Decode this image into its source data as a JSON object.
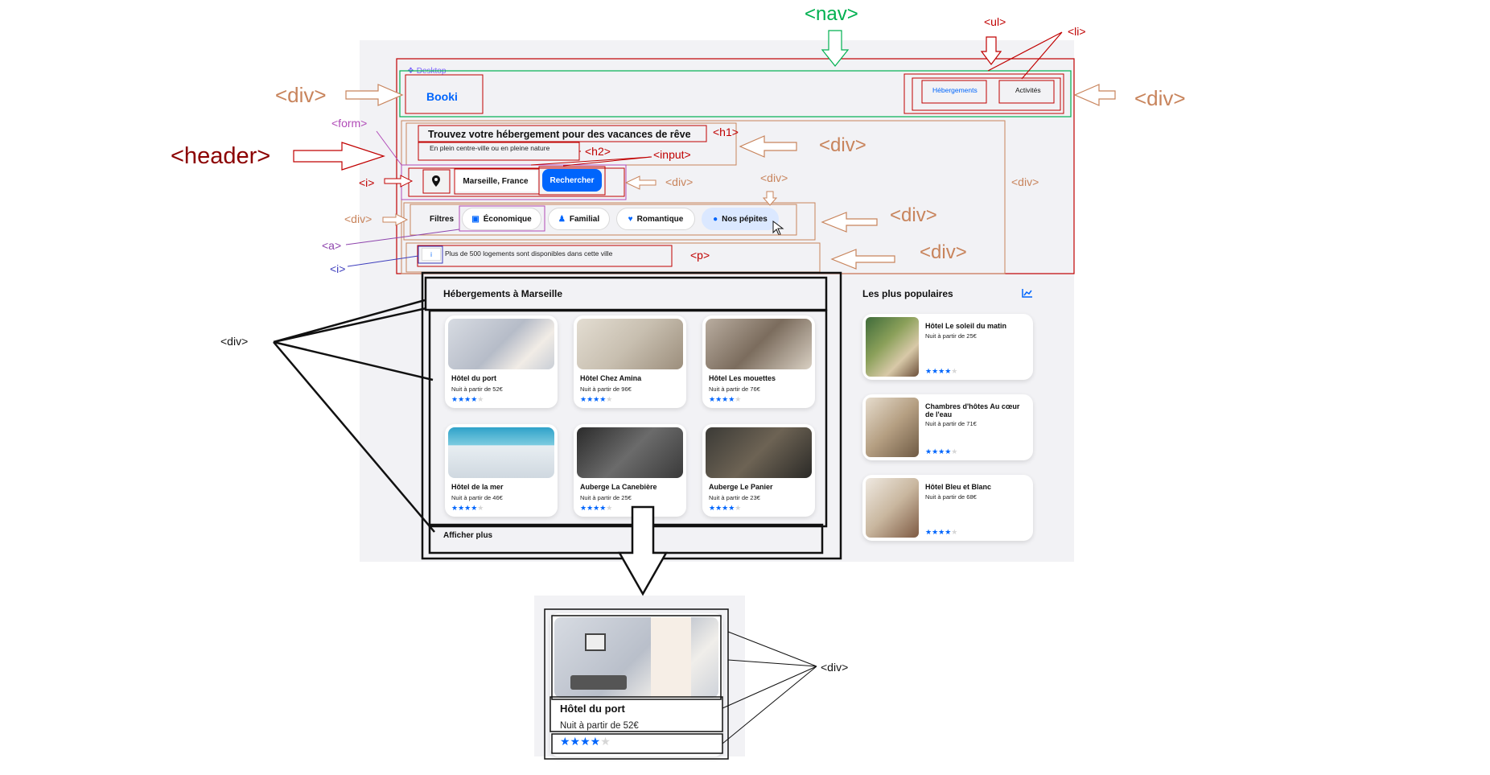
{
  "page": {
    "brand_label": "Desktop",
    "logo": "Booki",
    "nav_items": [
      "Hébergements",
      "Activités"
    ],
    "hero_title": "Trouvez votre hébergement pour des vacances de rêve",
    "hero_subtitle": "En plein centre-ville ou en pleine nature",
    "search_value": "Marseille, France",
    "search_button": "Rechercher",
    "filters_label": "Filtres",
    "filters": [
      {
        "label": "Économique",
        "icon": "money-icon"
      },
      {
        "label": "Familial",
        "icon": "person-icon"
      },
      {
        "label": "Romantique",
        "icon": "heart-icon"
      },
      {
        "label": "Nos pépites",
        "icon": "gem-icon"
      }
    ],
    "info_text": "Plus de 500 logements sont disponibles dans cette ville",
    "info_icon": "i",
    "accommodations_title": "Hébergements à Marseille",
    "show_more": "Afficher plus",
    "popular_title": "Les plus populaires",
    "accommodations": [
      {
        "name": "Hôtel du port",
        "price": "Nuit à partir de 52€",
        "rating": 4
      },
      {
        "name": "Hôtel Chez Amina",
        "price": "Nuit à partir de 96€",
        "rating": 4
      },
      {
        "name": "Hôtel Les mouettes",
        "price": "Nuit à partir de 76€",
        "rating": 4
      },
      {
        "name": "Hôtel de la mer",
        "price": "Nuit à partir de 46€",
        "rating": 4
      },
      {
        "name": "Auberge La Canebière",
        "price": "Nuit à partir de 25€",
        "rating": 4
      },
      {
        "name": "Auberge Le Panier",
        "price": "Nuit à partir de 23€",
        "rating": 4
      }
    ],
    "popular": [
      {
        "name": "Hôtel Le soleil du matin",
        "price": "Nuit à partir de 25€",
        "rating": 4
      },
      {
        "name": "Chambres d'hôtes Au cœur de l'eau",
        "price": "Nuit à partir de 71€",
        "rating": 4
      },
      {
        "name": "Hôtel Bleu et Blanc",
        "price": "Nuit à partir de 68€",
        "rating": 4
      }
    ],
    "zoom_card": {
      "name": "Hôtel du port",
      "price": "Nuit à partir de 52€",
      "rating": 4
    }
  },
  "annotations": {
    "nav": "<nav>",
    "ul": "<ul>",
    "li": "<li>",
    "header": "<header>",
    "div": "<div>",
    "form": "<form>",
    "h1": "<h1>",
    "h2": "<h2>",
    "input": "<input>",
    "i": "<i>",
    "a": "<a>",
    "p": "<p>"
  },
  "colors": {
    "accent": "#0065fc",
    "nav_green": "#00b050",
    "header_red": "#c00000",
    "div_brown": "#c8845c",
    "form_purple": "#b14bb8",
    "a_purple": "#8e44ad",
    "i_blue": "#3d3dbd"
  }
}
